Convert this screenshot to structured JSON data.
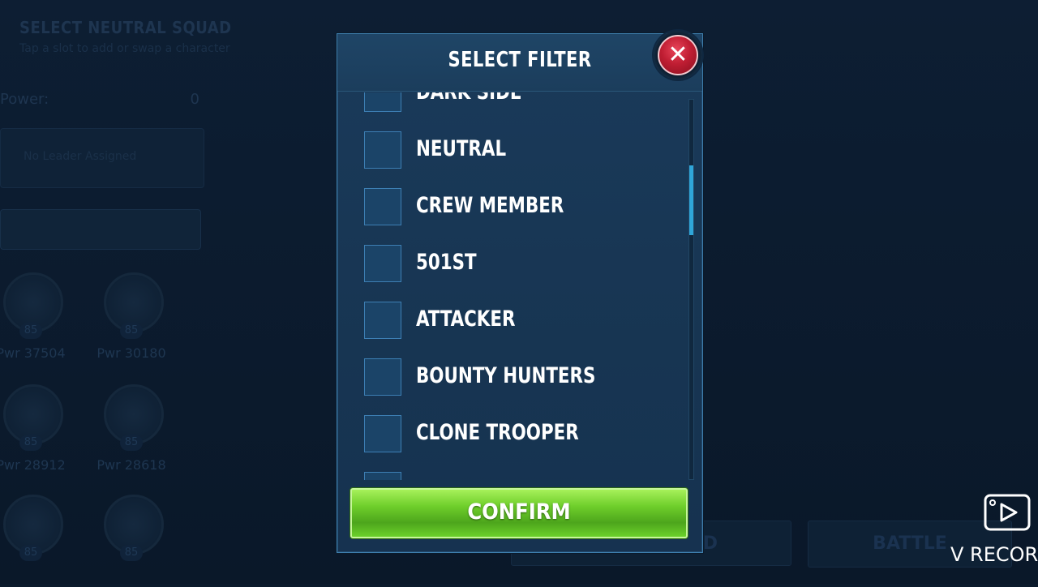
{
  "background": {
    "title": "SELECT NEUTRAL SQUAD",
    "subtitle": "Tap a slot to add or swap a character",
    "power_label": "Power:",
    "power_value": "0",
    "slot_text": "No Leader Assigned",
    "characters": [
      {
        "level": "85",
        "power": "Pwr 37504"
      },
      {
        "level": "85",
        "power": "Pwr 30180"
      },
      {
        "level": "85",
        "power": "Pwr 28912"
      },
      {
        "level": "85",
        "power": "Pwr 28618"
      },
      {
        "level": "85",
        "power": ""
      },
      {
        "level": "85",
        "power": ""
      }
    ],
    "squad_button": "SQUAD",
    "battle_button": "BATTLE"
  },
  "modal": {
    "title": "SELECT FILTER",
    "close_icon": "close-x-icon",
    "items": [
      {
        "label": "DARK SIDE",
        "checked": false
      },
      {
        "label": "NEUTRAL",
        "checked": false
      },
      {
        "label": "CREW MEMBER",
        "checked": false
      },
      {
        "label": "501ST",
        "checked": false
      },
      {
        "label": "ATTACKER",
        "checked": false
      },
      {
        "label": "BOUNTY HUNTERS",
        "checked": false
      },
      {
        "label": "CLONE TROOPER",
        "checked": false
      },
      {
        "label": "",
        "checked": false
      }
    ],
    "confirm_label": "CONFIRM"
  },
  "watermark": {
    "text": "V RECOR",
    "icon": "video-play-icon"
  },
  "colors": {
    "modal_bg": "#1a3a5a",
    "confirm_green": "#6fcf2b",
    "close_red": "#c01e33",
    "scroll_thumb": "#2fa6d9"
  }
}
